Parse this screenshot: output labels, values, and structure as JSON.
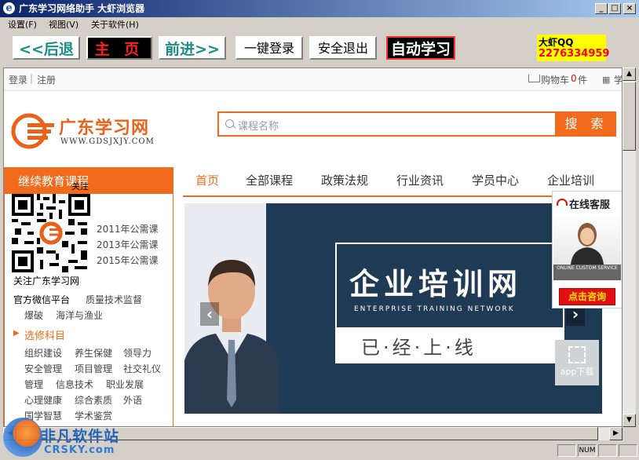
{
  "window": {
    "title": "广东学习网络助手  大虾浏览器",
    "app_icon": "e",
    "controls": {
      "minimize": "_",
      "maximize": "□",
      "close": "×"
    }
  },
  "menu": [
    "设置(F)",
    "视图(V)",
    "关于软件(H)"
  ],
  "toolbar": {
    "back": "<<后退",
    "home": "主 页",
    "forward": "前进>>",
    "login": "一键登录",
    "logout": "安全退出",
    "auto_study": "自动学习",
    "qq_label": "大虾QQ",
    "qq_number": "2276334959"
  },
  "site": {
    "topbar": {
      "login": "登录",
      "separator": "|",
      "register": "注册",
      "cart": "购物车",
      "cart_count": "0",
      "cart_unit": "件",
      "more": "学"
    },
    "logo": {
      "name": "广东学习网",
      "url": "WWW.GDSJXJY.COM"
    },
    "search": {
      "placeholder": "课程名称",
      "button": "搜 索"
    },
    "sidebar": {
      "heading": "继续教育课程",
      "qr_caption_top": "关注",
      "qr_follow": "关注广东学习网",
      "years": [
        "2011年公需课",
        "2013年公需课",
        "2015年公需课"
      ],
      "wechat": "官方微信平台",
      "links_row1": [
        "质量技术监督"
      ],
      "links_row2": [
        "爆破",
        "海洋与渔业"
      ],
      "elective_title": "选修科目",
      "electives": [
        [
          "组织建设",
          "养生保健",
          "领导力"
        ],
        [
          "安全管理",
          "项目管理",
          "社交礼仪"
        ],
        [
          "管理",
          "信息技术",
          "职业发展"
        ],
        [
          "心理健康",
          "综合素质",
          "外语"
        ],
        [
          "国学智慧",
          "学术鉴赏"
        ]
      ]
    },
    "nav": [
      "首页",
      "全部课程",
      "政策法规",
      "行业资讯",
      "学员中心",
      "企业培训"
    ],
    "banner": {
      "title": "企业培训网",
      "subtitle": "ENTERPRISE TRAINING NETWORK",
      "tagline": "已·经·上·线",
      "prev": "‹",
      "next": "›"
    },
    "service": {
      "title": "在线客服",
      "strip": "ONLINE CUSTOM SERVICE",
      "button": "点击咨询"
    },
    "app_download": "app下载"
  },
  "status": {
    "num": "NUM"
  },
  "watermark": {
    "cn": "非凡软件站",
    "en": "CRSKY.com"
  },
  "colors": {
    "accent": "#f26b1d",
    "titlebar": "#0a246a",
    "qq_bg": "#ffff00",
    "qq_text": "#ff0000"
  }
}
